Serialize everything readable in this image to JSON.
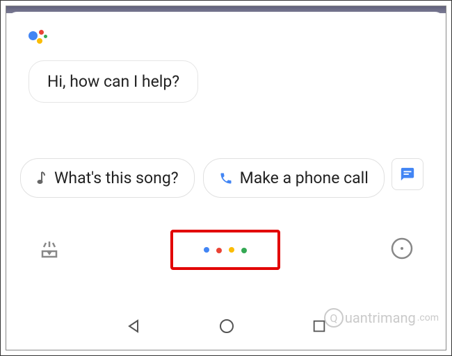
{
  "assistant": {
    "greeting": "Hi, how can I help?"
  },
  "suggestions": [
    {
      "icon": "music-note",
      "label": "What's this song?"
    },
    {
      "icon": "phone",
      "label": "Make a phone call"
    },
    {
      "icon": "chat",
      "label": ""
    }
  ],
  "colors": {
    "google_blue": "#4285F4",
    "google_red": "#EA4335",
    "google_yellow": "#FBBC05",
    "google_green": "#34A853",
    "highlight_red": "#e20000"
  },
  "watermark": {
    "text": "uantrimang",
    "suffix": ".com",
    "initial": "Q"
  }
}
